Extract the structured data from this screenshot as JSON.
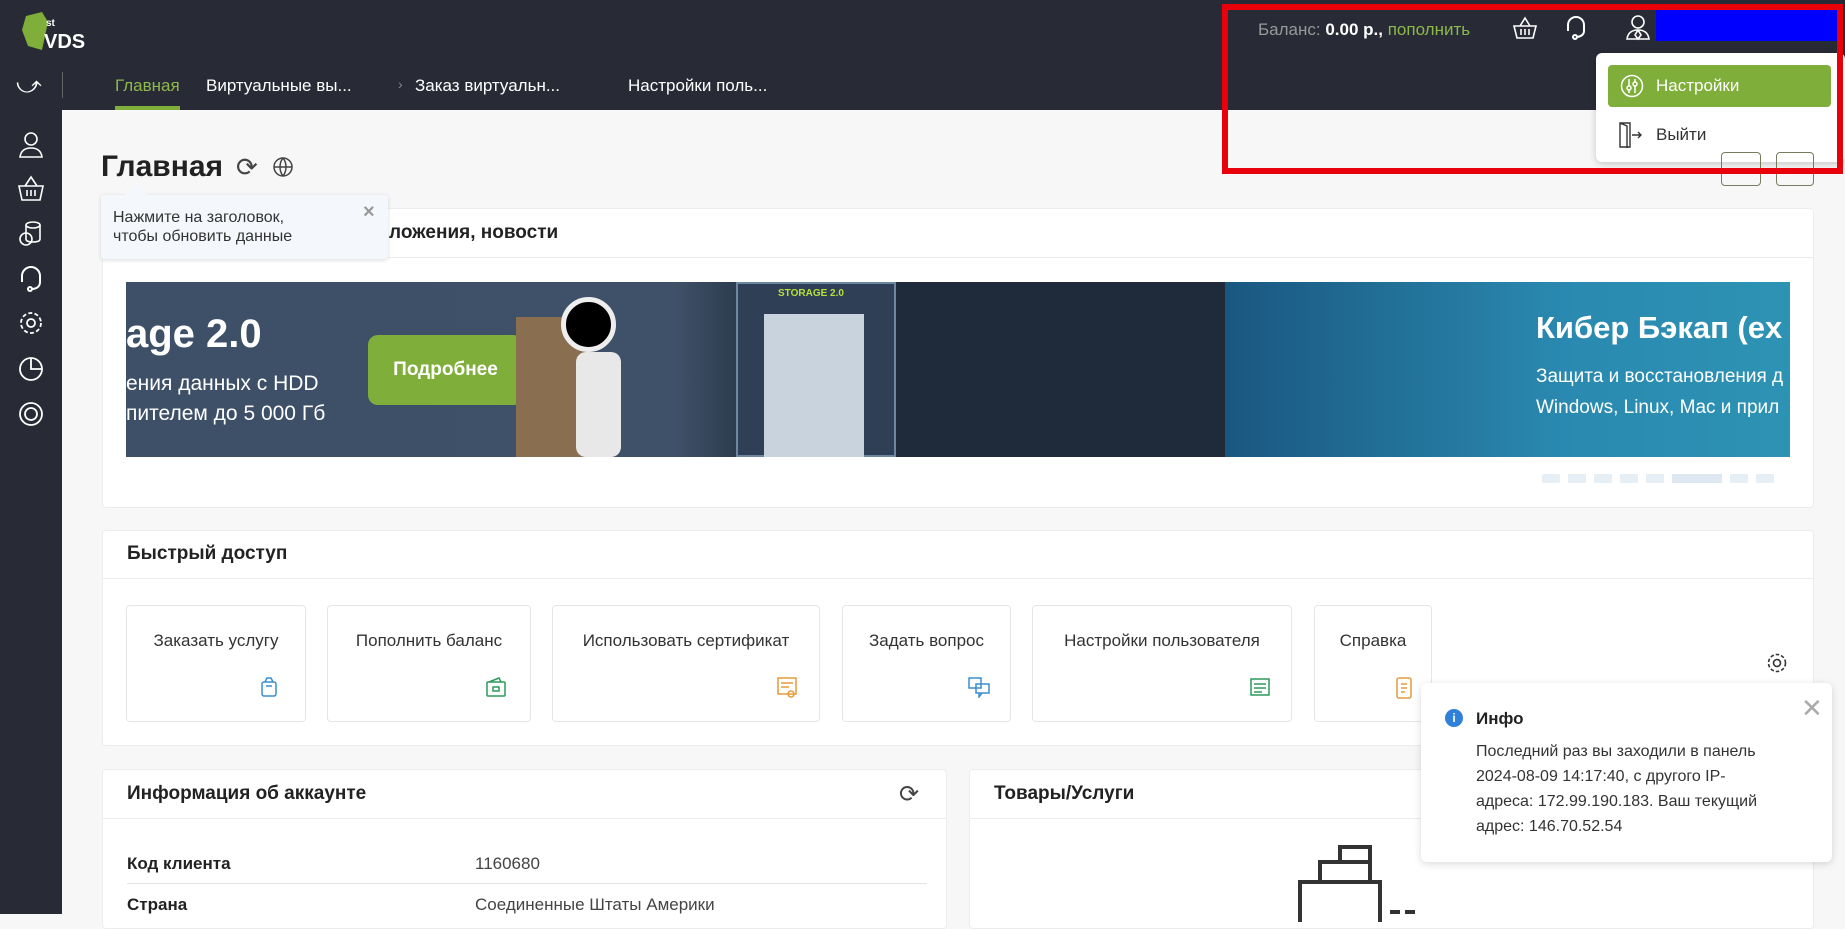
{
  "logo": {
    "text": "1st VDS",
    "accent": "#7fae3a"
  },
  "nav_tabs": [
    {
      "label": "Главная",
      "active": true
    },
    {
      "label": "Виртуальные вы..."
    },
    {
      "label": "Заказ виртуальн..."
    },
    {
      "label": "Настройки поль..."
    }
  ],
  "header": {
    "balance_label": "Баланс:",
    "balance_value": "0.00 р.,",
    "topup_link": "пополнить"
  },
  "user_menu": {
    "items": [
      {
        "label": "Настройки",
        "icon": "sliders-icon"
      },
      {
        "label": "Выйти",
        "icon": "logout-icon"
      }
    ]
  },
  "page": {
    "title": "Главная"
  },
  "tooltip": {
    "text_line1": "Нажмите на заголовок,",
    "text_line2": "чтобы обновить данные",
    "close": "×"
  },
  "news": {
    "title": "Предложения, новости",
    "title_visible": "ложения, новости",
    "banner1": {
      "title": "age 2.0",
      "line1": "ения данных с HDD",
      "line2": "пителем до 5 000 Гб",
      "button": "Подробнее",
      "sign": "STORAGE 2.0"
    },
    "banner2": {
      "title": "Кибер Бэкап (ex",
      "line1": "Защита и восстановления д",
      "line2": "Windows, Linux, Mac и прил"
    }
  },
  "quick_access": {
    "title": "Быстрый доступ",
    "tiles": [
      {
        "label": "Заказать услугу",
        "icon": "cart-doc-icon",
        "color": "#3a8fd0"
      },
      {
        "label": "Пополнить баланс",
        "icon": "wallet-icon",
        "color": "#2e9a5a"
      },
      {
        "label": "Использовать сертификат",
        "icon": "certificate-icon",
        "color": "#e59a3a"
      },
      {
        "label": "Задать вопрос",
        "icon": "chat-icon",
        "color": "#3a8fd0"
      },
      {
        "label": "Настройки пользователя",
        "icon": "user-settings-icon",
        "color": "#2e9a5a"
      },
      {
        "label": "Справка",
        "icon": "help-doc-icon",
        "color": "#e59a3a"
      }
    ]
  },
  "account": {
    "title": "Информация об аккаунте",
    "rows": [
      {
        "label": "Код клиента",
        "value": "1160680"
      },
      {
        "label": "Страна",
        "value": "Соединенные Штаты Америки"
      }
    ]
  },
  "products": {
    "title": "Товары/Услуги"
  },
  "toast": {
    "title": "Инфо",
    "lines": [
      "Последний раз вы заходили в панель",
      "2024-08-09 14:17:40, с другого IP-",
      "адреса: 172.99.190.183. Ваш текущий",
      "адрес: 146.70.52.54"
    ]
  }
}
